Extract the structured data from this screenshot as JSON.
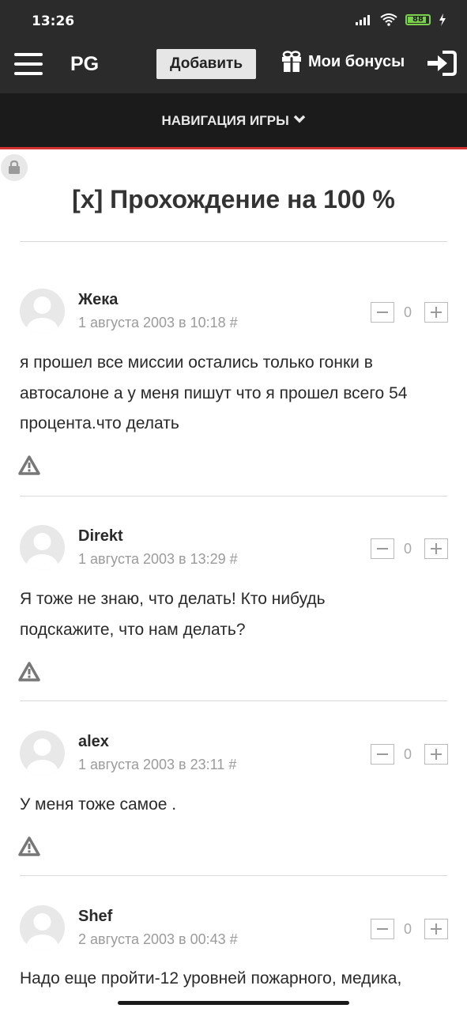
{
  "status": {
    "time": "13:26",
    "battery": "88",
    "battery_level": 0.88
  },
  "header": {
    "logo": "PG",
    "add_label": "Добавить",
    "bonus_label": "Мои бонусы"
  },
  "nav": {
    "label": "НАВИГАЦИЯ ИГРЫ"
  },
  "page": {
    "title": "[x] Прохождение на 100 %"
  },
  "comments": [
    {
      "author": "Жека",
      "date": "1 августа 2003 в 10:18 #",
      "score": "0",
      "text": [
        "я прошел все миссии остались только гонки в",
        "автосалоне а у меня пишут что я прошел всего 54",
        "процента.что делать"
      ]
    },
    {
      "author": "Direkt",
      "date": "1 августа 2003 в 13:29 #",
      "score": "0",
      "text": [
        "Я тоже не знаю, что делать! Кто нибудь",
        "подскажите, что нам делать?"
      ]
    },
    {
      "author": "alex",
      "date": "1 августа 2003 в 23:11 #",
      "score": "0",
      "text": [
        "У меня тоже самое ."
      ]
    },
    {
      "author": "Shef",
      "date": "2 августа 2003 в 00:43 #",
      "score": "0",
      "text": [
        "Надо еще пройти-12 уровней пожарного, медика,"
      ]
    }
  ],
  "colors": {
    "bar": "#2b2b2b",
    "nav": "#1b1b1b",
    "accent": "#d43131",
    "battery": "#7bd14a"
  },
  "icons": [
    "hamburger-icon",
    "gift-icon",
    "login-icon",
    "chevron-down-icon",
    "lock-icon",
    "avatar-placeholder-icon",
    "warning-icon",
    "minus-icon",
    "plus-icon",
    "signal-icon",
    "wifi-icon",
    "battery-icon",
    "charging-icon"
  ]
}
